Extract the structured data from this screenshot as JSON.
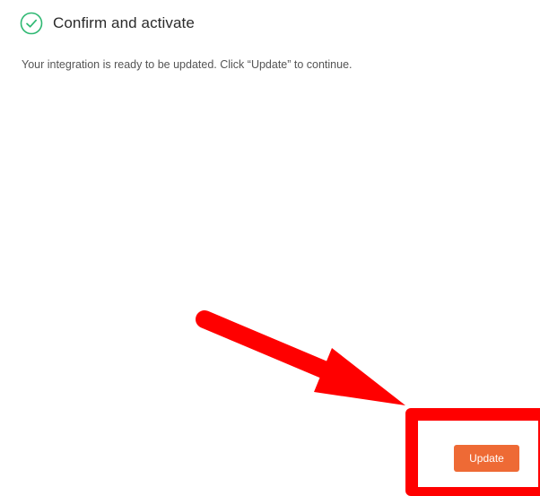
{
  "step": {
    "title": "Confirm and activate",
    "status_icon": "check-circle-icon",
    "status_color": "#2eb872"
  },
  "description": "Your integration is ready to be updated. Click “Update” to continue.",
  "actions": {
    "update_label": "Update",
    "update_color": "#ee6a35"
  },
  "annotation": {
    "arrow_icon": "red-arrow",
    "highlight_color": "#ff0000"
  }
}
